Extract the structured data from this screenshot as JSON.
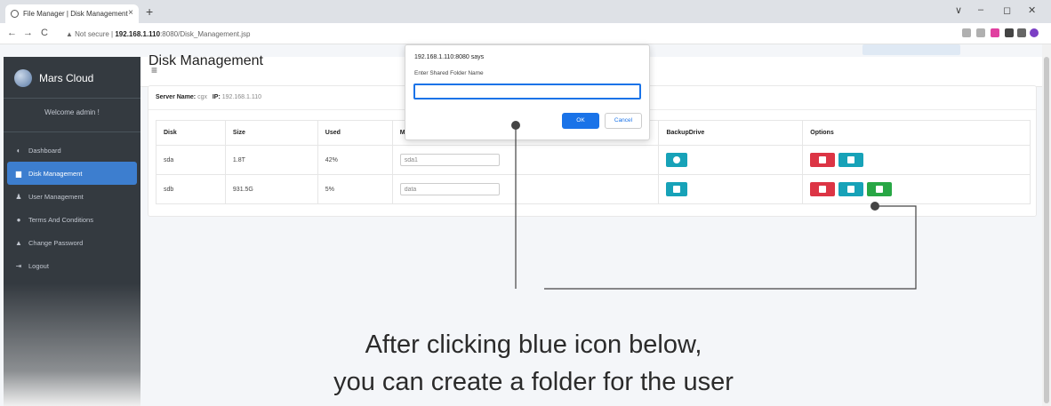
{
  "browser": {
    "tab_title": "File Manager | Disk Management",
    "tab_close": "×",
    "new_tab": "+",
    "back": "←",
    "forward": "→",
    "reload": "C",
    "security_label": "▲ Not secure |",
    "url_host": "192.168.1.110",
    "url_rest": ":8080/Disk_Management.jsp",
    "window_controls": [
      "∨",
      "–",
      "◻",
      "✕"
    ],
    "colors": {
      "chrome": "#dee1e6",
      "accent": "#1a73e8"
    }
  },
  "sidebar": {
    "brand": "Mars Cloud",
    "welcome": "Welcome admin !",
    "items": [
      {
        "icon": "dashboard-icon",
        "glyph": "◐",
        "label": "Dashboard",
        "active": false
      },
      {
        "icon": "disk-icon",
        "glyph": "▆",
        "label": "Disk Management",
        "active": true
      },
      {
        "icon": "user-icon",
        "glyph": "♟",
        "label": "User Management",
        "active": false
      },
      {
        "icon": "comment-icon",
        "glyph": "●",
        "label": "Terms And Conditions",
        "active": false
      },
      {
        "icon": "lock-icon",
        "glyph": "▲",
        "label": "Change Password",
        "active": false
      },
      {
        "icon": "logout-icon",
        "glyph": "⇥",
        "label": "Logout",
        "active": false
      }
    ],
    "colors": {
      "background": "#343a40",
      "active": "#3d7ecf"
    }
  },
  "topbar": {
    "menu_glyph": "≡"
  },
  "page": {
    "title": "Disk Management",
    "server_name_label": "Server Name:",
    "server_name": "cgx",
    "ip_label": "IP:",
    "ip": "192.168.1.110"
  },
  "table": {
    "headers": [
      "Disk",
      "Size",
      "Used",
      "MountPoint",
      "BackupDrive",
      "Options"
    ],
    "rows": [
      {
        "disk": "sda",
        "size": "1.8T",
        "used": "42%",
        "mountpoint": "sda1"
      },
      {
        "disk": "sdb",
        "size": "931.5G",
        "used": "5%",
        "mountpoint": "data"
      }
    ]
  },
  "dialog": {
    "origin": "192.168.1.110:8080 says",
    "message": "Enter Shared Folder Name",
    "input_value": "",
    "ok_label": "OK",
    "cancel_label": "Cancel"
  },
  "annotation": {
    "caption_line1": "After clicking blue icon below,",
    "caption_line2": "you can create a folder for the user"
  }
}
